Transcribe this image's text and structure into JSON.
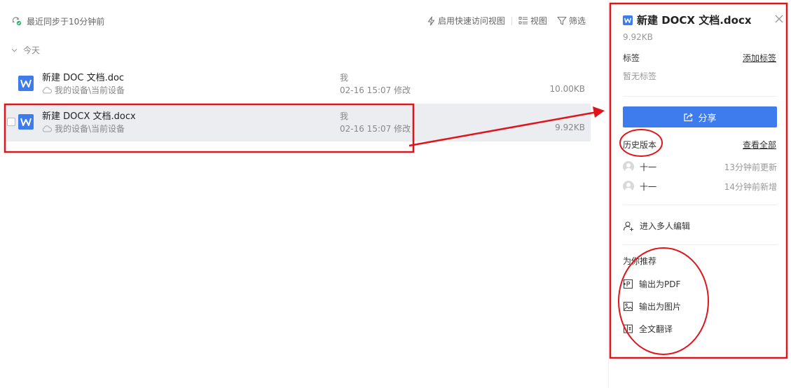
{
  "sync": {
    "status": "最近同步于10分钟前",
    "icon": "cloud-sync-icon"
  },
  "toolbar": {
    "quick_access": "启用快速访问视图",
    "view": "视图",
    "filter": "筛选"
  },
  "group": {
    "label": "今天"
  },
  "files": [
    {
      "name": "新建 DOC 文档.doc",
      "path": "我的设备\\当前设备",
      "owner": "我",
      "modified": "02-16 15:07 修改",
      "size": "10.00KB"
    },
    {
      "name": "新建 DOCX 文档.docx",
      "path": "我的设备\\当前设备",
      "owner": "我",
      "modified": "02-16 15:07 修改",
      "size": "9.92KB"
    }
  ],
  "details": {
    "title": "新建 DOCX 文档.docx",
    "size": "9.92KB",
    "tags_label": "标签",
    "add_tag": "添加标签",
    "no_tags": "暂无标签",
    "share": "分享",
    "history_label": "历史版本",
    "view_all": "查看全部",
    "versions": [
      {
        "user": "十一",
        "time": "13分钟前更新"
      },
      {
        "user": "十一",
        "time": "14分钟前新增"
      }
    ],
    "multi_edit": "进入多人编辑",
    "recommend_label": "为你推荐",
    "actions": [
      "输出为PDF",
      "输出为图片",
      "全文翻译"
    ]
  },
  "colors": {
    "accent": "#3e7bed",
    "annotation": "#e0151b",
    "selected_row": "#ebedf1"
  }
}
